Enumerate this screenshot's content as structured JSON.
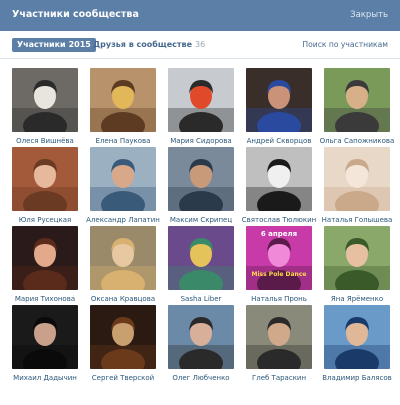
{
  "header": {
    "title": "Участники сообщества",
    "close_label": "Закрыть"
  },
  "tabs": {
    "active": {
      "label": "Участники",
      "count": "2015"
    },
    "second": {
      "label": "Друзья в сообществе",
      "count": "36"
    },
    "search_link": "Поиск по участникам"
  },
  "colors": {
    "header_bg": "#5b7fa6",
    "link": "#2b587a",
    "accent": "#45688e"
  },
  "members": [
    {
      "name": "Олеся Вишнёва",
      "avatar_colors": [
        "#6d6a66",
        "#e8e4de",
        "#2a2a2a"
      ]
    },
    {
      "name": "Елена Паукова",
      "avatar_colors": [
        "#b8926a",
        "#e2b75a",
        "#5c3b22"
      ]
    },
    {
      "name": "Мария Сидорова",
      "avatar_colors": [
        "#c7cbcf",
        "#e04a2a",
        "#2a2a2a"
      ]
    },
    {
      "name": "Андрей Скворцов",
      "avatar_colors": [
        "#3a2e2a",
        "#c99279",
        "#2a4aa0"
      ]
    },
    {
      "name": "Ольга Сапожникова",
      "avatar_colors": [
        "#7a9a5a",
        "#d7b08a",
        "#3a3a3a"
      ]
    },
    {
      "name": "Юля Русецкая",
      "avatar_colors": [
        "#a35a3a",
        "#e6b99d",
        "#6b3a22"
      ]
    },
    {
      "name": "Александр Лапатин",
      "avatar_colors": [
        "#9bb0c0",
        "#d9a88a",
        "#3a5a7a"
      ]
    },
    {
      "name": "Максим Скрипец",
      "avatar_colors": [
        "#7a8a9a",
        "#c99a7a",
        "#2a3a4a"
      ]
    },
    {
      "name": "Святослав Тюлюкин",
      "avatar_colors": [
        "#bfbfbf",
        "#f0f0f0",
        "#1a1a1a"
      ]
    },
    {
      "name": "Наталья Голышева",
      "avatar_colors": [
        "#e8d8c8",
        "#f4e6d8",
        "#caa88a"
      ]
    },
    {
      "name": "Мария Тихонова",
      "avatar_colors": [
        "#2a1a1a",
        "#e2a98a",
        "#5a2a1a"
      ]
    },
    {
      "name": "Оксана Кравцова",
      "avatar_colors": [
        "#9a8a6a",
        "#e7c8a0",
        "#d8b070"
      ]
    },
    {
      "name": "Sasha Liber",
      "avatar_colors": [
        "#6a4a8a",
        "#e4c45a",
        "#3a8a6a"
      ]
    },
    {
      "name": "Наталья Пронь",
      "avatar_colors": [
        "#c83aa8",
        "#f08ad8",
        "#5a1a4a"
      ]
    },
    {
      "name": "Яна Ярёменко",
      "avatar_colors": [
        "#8aa86a",
        "#e6c0a0",
        "#3a5a2a"
      ]
    },
    {
      "name": "Михаил Дадычин",
      "avatar_colors": [
        "#1a1a1a",
        "#c9a08a",
        "#0a0a0a"
      ]
    },
    {
      "name": "Сергей Тверской",
      "avatar_colors": [
        "#2a1a12",
        "#c8a070",
        "#6a3a1a"
      ]
    },
    {
      "name": "Олег Любченко",
      "avatar_colors": [
        "#6a8aa8",
        "#d8b09a",
        "#2a2a2a"
      ]
    },
    {
      "name": "Глеб Тараскин",
      "avatar_colors": [
        "#8a8a7a",
        "#d0a88a",
        "#2a2a2a"
      ]
    },
    {
      "name": "Владимир Балясов",
      "avatar_colors": [
        "#6a9ac8",
        "#e0b898",
        "#1a3a6a"
      ]
    }
  ],
  "poster_text": {
    "date": "6 апреля",
    "title": "Miss Pole Dance"
  }
}
